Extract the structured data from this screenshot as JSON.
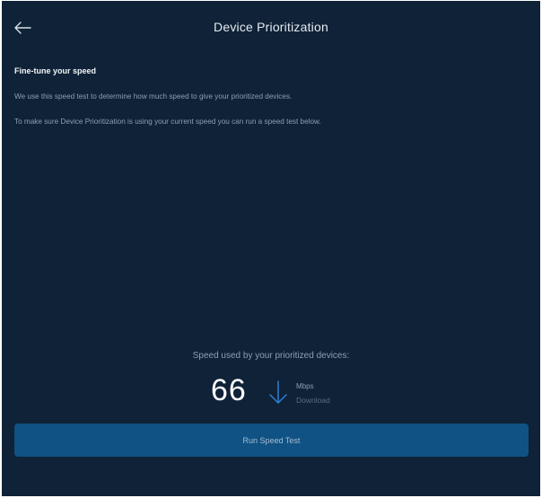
{
  "header": {
    "back_icon": "arrow-left-icon",
    "title": "Device Prioritization"
  },
  "content": {
    "section_title": "Fine-tune your speed",
    "paragraph_1": "We use this speed test to determine how much speed to give your prioritized devices.",
    "paragraph_2": "To make sure Device Prioritization is using your current speed you can run a speed test below."
  },
  "speed": {
    "label": "Speed used by your prioritized devices:",
    "value": "66",
    "icon": "arrow-down-icon",
    "unit": "Mbps",
    "direction": "Download"
  },
  "actions": {
    "run_speed_test_label": "Run Speed Test"
  },
  "colors": {
    "background": "#0f2237",
    "accent": "#0f5283",
    "arrow": "#2f7fd6"
  }
}
